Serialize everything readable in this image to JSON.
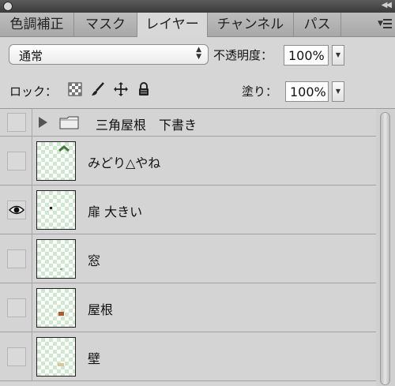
{
  "tabs": [
    {
      "label": "色調補正",
      "active": false
    },
    {
      "label": "マスク",
      "active": false
    },
    {
      "label": "レイヤー",
      "active": true
    },
    {
      "label": "チャンネル",
      "active": false
    },
    {
      "label": "パス",
      "active": false
    }
  ],
  "blend": {
    "mode": "通常"
  },
  "opacity": {
    "label": "不透明度：",
    "value": "100%"
  },
  "lock": {
    "label": "ロック：",
    "icons": [
      "lock-transparent-icon",
      "lock-paint-icon",
      "lock-position-icon",
      "lock-all-icon"
    ]
  },
  "fill": {
    "label": "塗り：",
    "value": "100%"
  },
  "layers": [
    {
      "name": "三角屋根　下書き",
      "type": "group",
      "visible": false,
      "expanded": false
    },
    {
      "name": "みどり△やね",
      "type": "layer",
      "visible": false
    },
    {
      "name": "扉 大きい",
      "type": "layer",
      "visible": true
    },
    {
      "name": "窓",
      "type": "layer",
      "visible": false
    },
    {
      "name": "屋根",
      "type": "layer",
      "visible": false
    },
    {
      "name": "壁",
      "type": "layer",
      "visible": false
    }
  ],
  "colors": {
    "roof_green": "#3f7a3c",
    "door_dark": "#222222",
    "roof_brown": "#b0582e",
    "wall_tan": "#d9c79a"
  }
}
